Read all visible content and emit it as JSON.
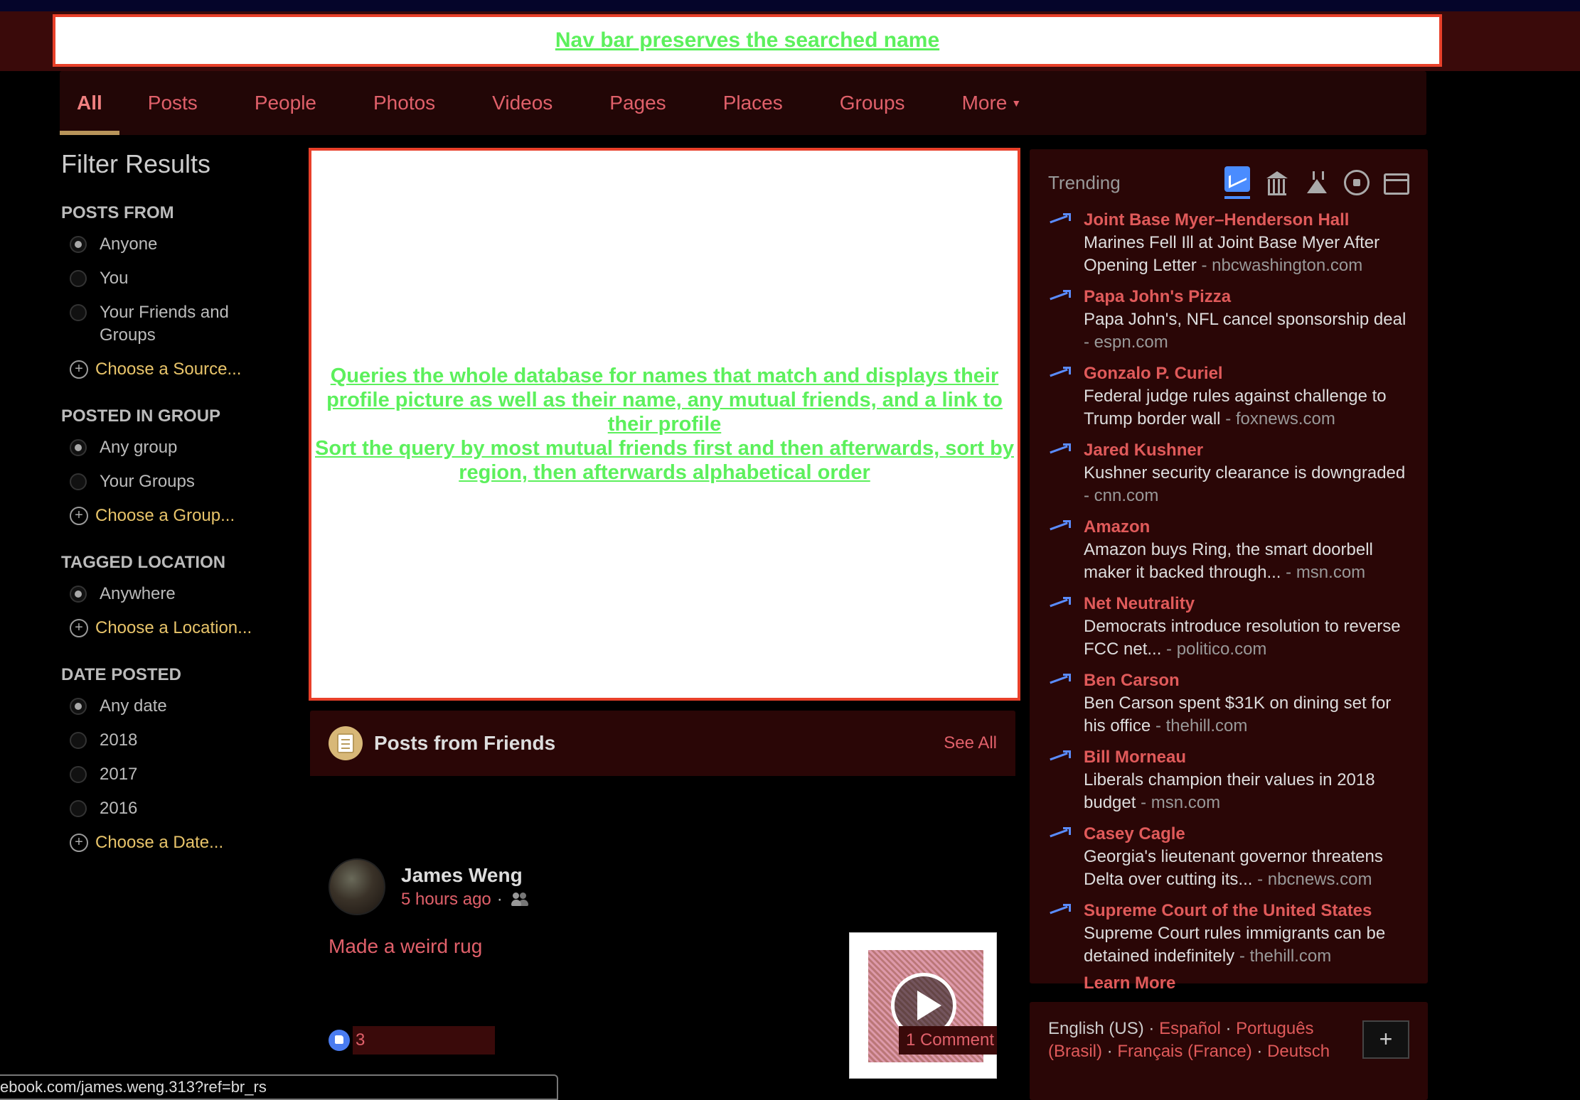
{
  "annotations": {
    "nav_note": "Nav bar preserves the searched name",
    "main_note_1": "Queries the whole database for names that match and displays their profile picture as well as their name, any mutual friends, and a link to their profile",
    "main_note_2": "Sort the query by most mutual friends first and then afterwards, sort by region, then afterwards alphabetical order"
  },
  "tabs": [
    {
      "label": "All",
      "active": true
    },
    {
      "label": "Posts"
    },
    {
      "label": "People"
    },
    {
      "label": "Photos"
    },
    {
      "label": "Videos"
    },
    {
      "label": "Pages"
    },
    {
      "label": "Places"
    },
    {
      "label": "Groups"
    },
    {
      "label": "More"
    }
  ],
  "filters": {
    "title": "Filter Results",
    "posts_from": {
      "heading": "POSTS FROM",
      "options": [
        "Anyone",
        "You",
        "Your Friends and Groups"
      ],
      "choose": "Choose a Source..."
    },
    "posted_in_group": {
      "heading": "POSTED IN GROUP",
      "options": [
        "Any group",
        "Your Groups"
      ],
      "choose": "Choose a Group..."
    },
    "tagged_location": {
      "heading": "TAGGED LOCATION",
      "options": [
        "Anywhere"
      ],
      "choose": "Choose a Location..."
    },
    "date_posted": {
      "heading": "DATE POSTED",
      "options": [
        "Any date",
        "2018",
        "2017",
        "2016"
      ],
      "choose": "Choose a Date..."
    }
  },
  "posts_section": {
    "title": "Posts from Friends",
    "see_all": "See All",
    "post": {
      "author": "James Weng",
      "time": "5 hours ago",
      "separator": "·",
      "text": "Made a weird rug",
      "likes": "3",
      "comments": "1 Comment"
    }
  },
  "trending": {
    "title": "Trending",
    "category_icons": [
      "trending-icon",
      "politics-icon",
      "science-icon",
      "sports-icon",
      "entertainment-icon"
    ],
    "items": [
      {
        "name": "Joint Base Myer–Henderson Hall",
        "desc": "Marines Fell Ill at Joint Base Myer After Opening Letter",
        "source": "- nbcwashington.com"
      },
      {
        "name": "Papa John's Pizza",
        "desc": "Papa John's, NFL cancel sponsorship deal",
        "source": "- espn.com"
      },
      {
        "name": "Gonzalo P. Curiel",
        "desc": "Federal judge rules against challenge to Trump border wall",
        "source": "- foxnews.com"
      },
      {
        "name": "Jared Kushner",
        "desc": "Kushner security clearance is downgraded",
        "source": "- cnn.com"
      },
      {
        "name": "Amazon",
        "desc": "Amazon buys Ring, the smart doorbell maker it backed through...",
        "source": "- msn.com"
      },
      {
        "name": "Net Neutrality",
        "desc": "Democrats introduce resolution to reverse FCC net...",
        "source": "- politico.com"
      },
      {
        "name": "Ben Carson",
        "desc": "Ben Carson spent $31K on dining set for his office",
        "source": "- thehill.com"
      },
      {
        "name": "Bill Morneau",
        "desc": "Liberals champion their values in 2018 budget",
        "source": "- msn.com"
      },
      {
        "name": "Casey Cagle",
        "desc": "Georgia's lieutenant governor threatens Delta over cutting its...",
        "source": "- nbcnews.com"
      },
      {
        "name": "Supreme Court of the United States",
        "desc": "Supreme Court rules immigrants can be detained indefinitely",
        "source": "- thehill.com"
      }
    ],
    "learn_more": "Learn More"
  },
  "languages": {
    "current": "English (US)",
    "others": [
      "Español",
      "Português (Brasil)",
      "Français (France)",
      "Deutsch"
    ],
    "separator": "·",
    "add_label": "+"
  },
  "status_url": "ebook.com/james.weng.313?ref=br_rs",
  "colors": {
    "accent_red": "#e05a5a",
    "nav_bg": "#220606",
    "annotation_green": "#5cf05c",
    "annotation_border": "#e8402a",
    "trend_blue": "#4a8cff",
    "link_gold": "#e8c46a"
  }
}
